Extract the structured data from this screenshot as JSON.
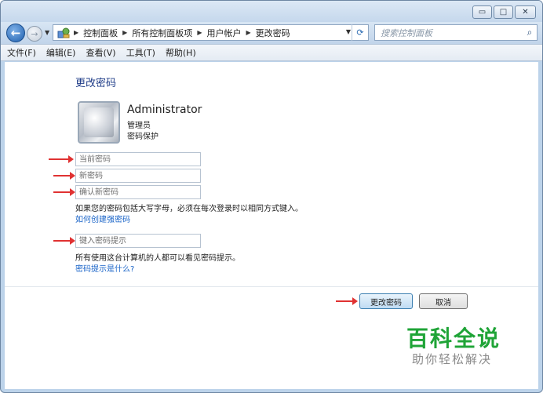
{
  "window": {
    "minimize_glyph": "▭",
    "maximize_glyph": "□",
    "close_glyph": "✕"
  },
  "nav": {
    "back_glyph": "←",
    "forward_glyph": "→",
    "history_glyph": "▼",
    "breadcrumb": [
      "控制面板",
      "所有控制面板项",
      "用户帐户",
      "更改密码"
    ],
    "breadcrumb_sep_glyph": "▶",
    "dropdown_glyph": "▼",
    "refresh_glyph": "⟳",
    "address_icon": "control-panel-icon",
    "search_placeholder": "搜索控制面板",
    "search_glyph": "⌕"
  },
  "menu": [
    "文件(F)",
    "编辑(E)",
    "查看(V)",
    "工具(T)",
    "帮助(H)"
  ],
  "page": {
    "title": "更改密码",
    "user": {
      "name": "Administrator",
      "role": "管理员",
      "status": "密码保护"
    },
    "fields": {
      "current_password_placeholder": "当前密码",
      "new_password_placeholder": "新密码",
      "confirm_password_placeholder": "确认新密码",
      "hint_placeholder": "键入密码提示"
    },
    "caps_note": "如果您的密码包括大写字母，必须在每次登录时以相同方式键入。",
    "strong_password_link": "如何创建强密码",
    "hint_note": "所有使用这台计算机的人都可以看见密码提示。",
    "hint_link": "密码提示是什么?",
    "change_button": "更改密码",
    "cancel_button": "取消"
  },
  "watermark": {
    "title": "百科全说",
    "subtitle": "助你轻松解决"
  },
  "colors": {
    "accent_link": "#1a64c8",
    "title": "#1f3c88",
    "annotation_arrow": "#e03232",
    "watermark_green": "#1fa437"
  }
}
